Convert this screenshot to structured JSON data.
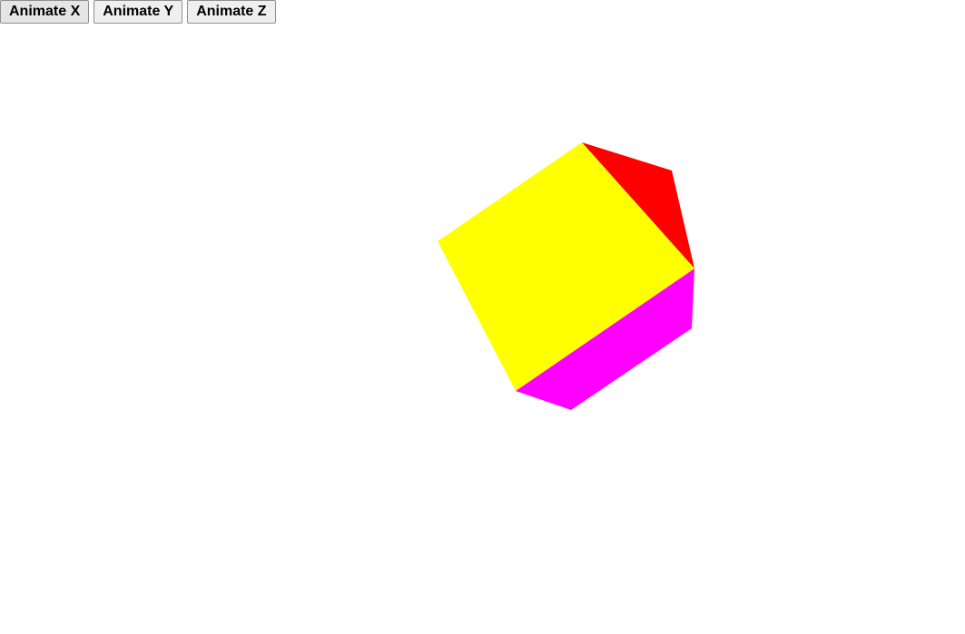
{
  "buttons": {
    "animate_x": "Animate X",
    "animate_y": "Animate Y",
    "animate_z": "Animate Z"
  },
  "cube": {
    "faces": [
      {
        "name": "front-face",
        "color": "#ffff00"
      },
      {
        "name": "top-face",
        "color": "#ff0000"
      },
      {
        "name": "bottom-face",
        "color": "#ff00ff"
      }
    ]
  }
}
